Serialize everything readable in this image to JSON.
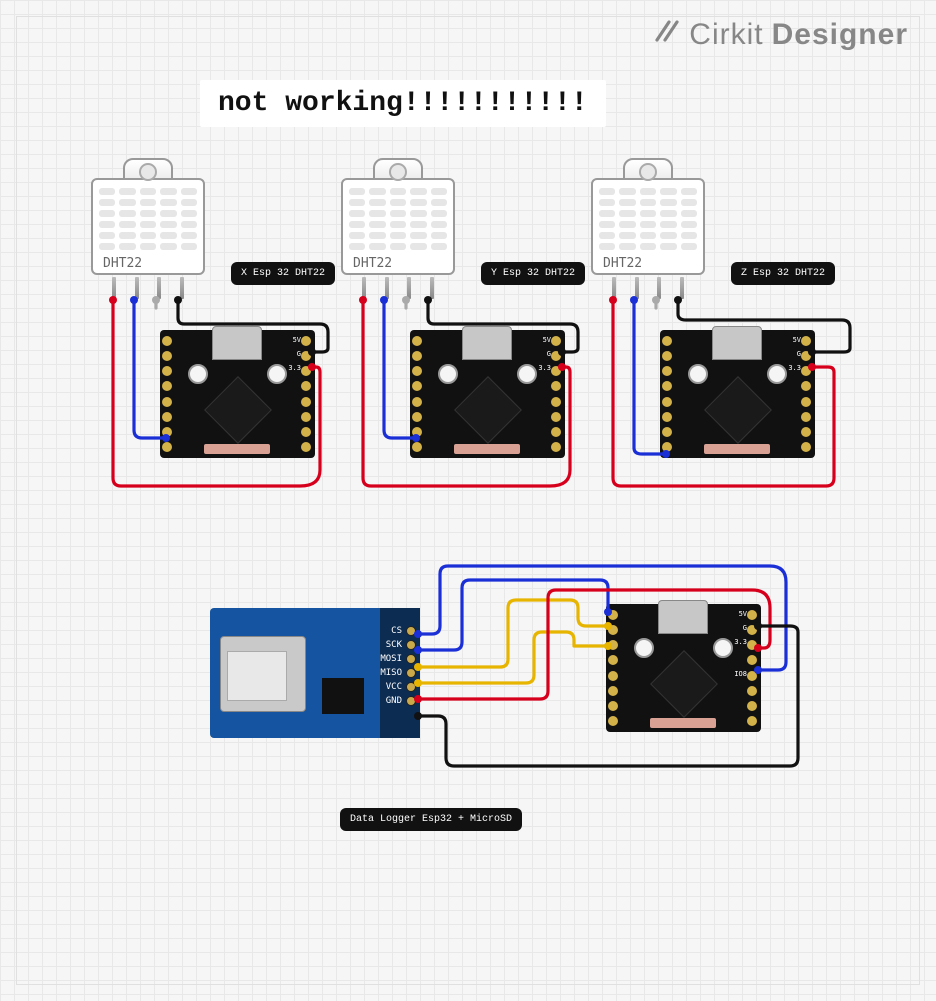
{
  "brand": {
    "name1": "Cirkit",
    "name2": "Designer"
  },
  "note": "not working!!!!!!!!!!!",
  "sensors": {
    "dht_label": "DHT22",
    "group_labels": [
      "X Esp 32 DHT22",
      "Y Esp 32 DHT22",
      "Z Esp 32 DHT22"
    ]
  },
  "logger_label": "Data Logger Esp32 + MicroSD",
  "sd_pins": [
    "CS",
    "SCK",
    "MOSI",
    "MISO",
    "VCC",
    "GND"
  ],
  "esp_pins": {
    "top_right": [
      "5V",
      "G",
      "3.3"
    ],
    "side": "IO8"
  },
  "wire_colors": {
    "red": "#d6001c",
    "blue": "#1b2fd6",
    "black": "#111",
    "yellow": "#e7b400",
    "grey": "#aaa"
  }
}
